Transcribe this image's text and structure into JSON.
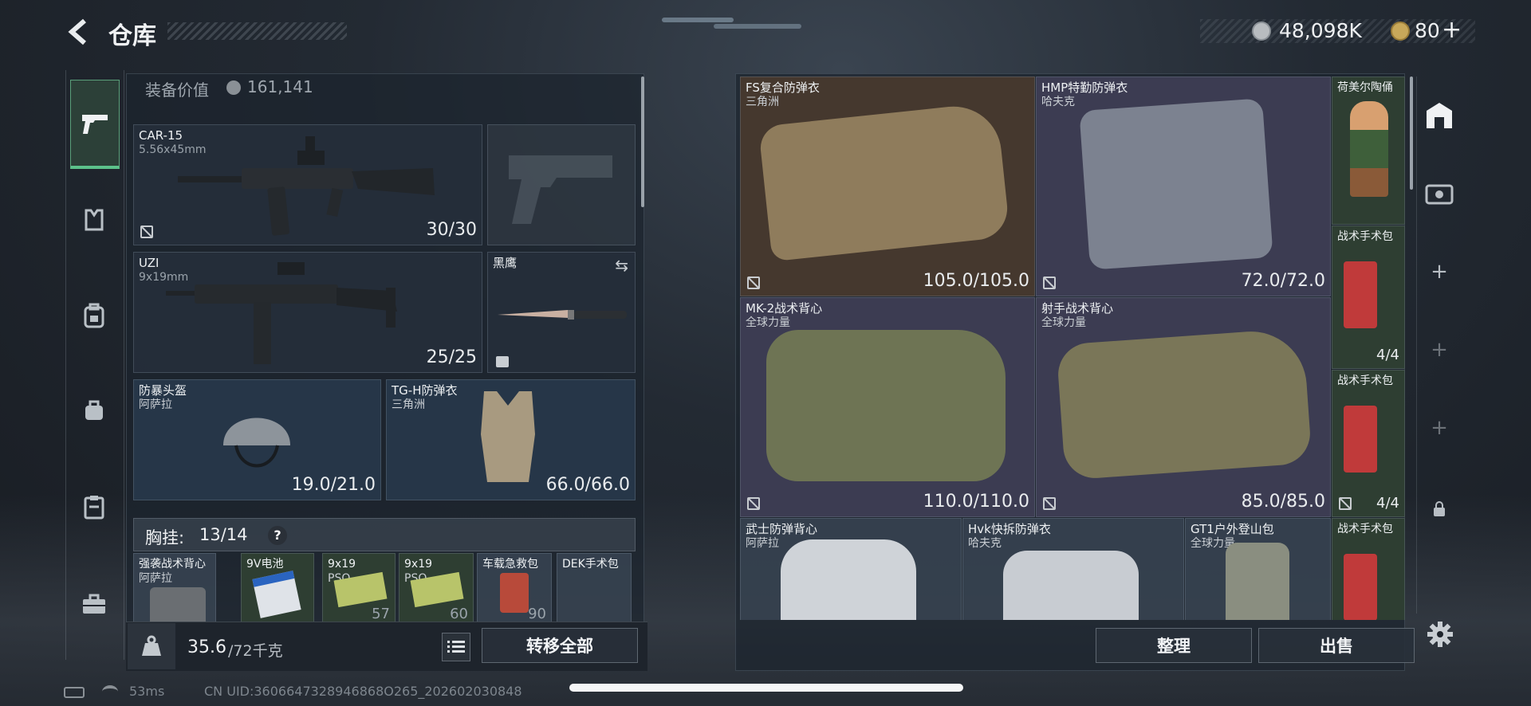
{
  "header": {
    "title": "仓库",
    "currency_value": "48,098K",
    "coin_value": "80",
    "coin_plus": "+"
  },
  "left_panel": {
    "equipment_value_label": "装备价值",
    "equipment_value": "161,141",
    "weapons": [
      {
        "name": "CAR-15",
        "caliber": "5.56x45mm",
        "ammo": "30/30"
      },
      {
        "name": "UZI",
        "caliber": "9x19mm",
        "ammo": "25/25"
      }
    ],
    "knife": {
      "name": "黑鹰"
    },
    "helmet": {
      "name": "防暴头盔",
      "maker": "阿萨拉",
      "durability": "19.0/21.0"
    },
    "armor": {
      "name": "TG-H防弹衣",
      "maker": "三角洲",
      "durability": "66.0/66.0"
    },
    "chest_rig": {
      "label": "胸挂:",
      "capacity": "13/14",
      "help": "?"
    },
    "rig_items": [
      {
        "name": "强袭战术背心",
        "maker": "阿萨拉"
      },
      {
        "name": "9V电池",
        "maker": ""
      },
      {
        "name": "9x19",
        "maker": "PSO",
        "count": "57"
      },
      {
        "name": "9x19",
        "maker": "PSO",
        "count": "60"
      },
      {
        "name": "车载急救包",
        "maker": "",
        "count": "90"
      },
      {
        "name": "DEK手术包",
        "maker": ""
      }
    ],
    "weight": {
      "value": "35.6",
      "max": "/72千克"
    },
    "transfer_all": "转移全部"
  },
  "right_panel": {
    "items": [
      {
        "name": "FS复合防弹衣",
        "maker": "三角洲",
        "durability": "105.0/105.0"
      },
      {
        "name": "HMP特勤防弹衣",
        "maker": "哈夫克",
        "durability": "72.0/72.0"
      },
      {
        "name": "荷美尔陶俑",
        "maker": ""
      },
      {
        "name": "战术手术包",
        "maker": "",
        "count": "4/4"
      },
      {
        "name": "MK-2战术背心",
        "maker": "全球力量",
        "durability": "110.0/110.0"
      },
      {
        "name": "射手战术背心",
        "maker": "全球力量",
        "durability": "85.0/85.0"
      },
      {
        "name": "战术手术包",
        "maker": "",
        "count": "4/4"
      },
      {
        "name": "武士防弹背心",
        "maker": "阿萨拉"
      },
      {
        "name": "Hvk快拆防弹衣",
        "maker": "哈夫克"
      },
      {
        "name": "GT1户外登山包",
        "maker": "全球力量"
      },
      {
        "name": "战术手术包",
        "maker": ""
      }
    ],
    "sort_button": "整理",
    "sell_button": "出售"
  },
  "status_bar": {
    "ping": "53ms",
    "uid": "CN UID:3606647328946868O265_202602030848"
  }
}
